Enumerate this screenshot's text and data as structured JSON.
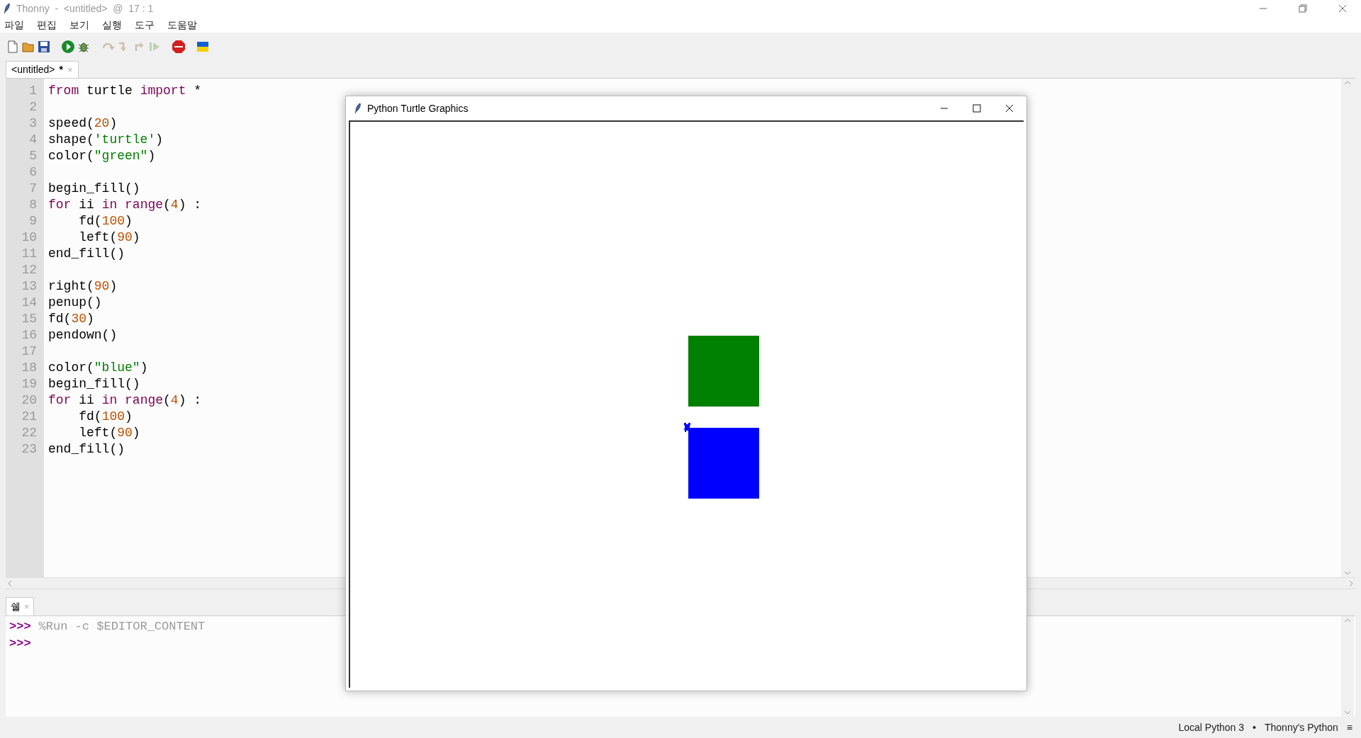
{
  "window": {
    "title": "Thonny  -  <untitled>  @  17 : 1"
  },
  "menu": [
    "파일",
    "편집",
    "보기",
    "실행",
    "도구",
    "도움말"
  ],
  "toolbar": [
    {
      "kind": "new",
      "disabled": false
    },
    {
      "kind": "open",
      "disabled": false
    },
    {
      "kind": "save",
      "disabled": false
    },
    {
      "kind": "run",
      "disabled": false
    },
    {
      "kind": "debug",
      "disabled": false
    },
    {
      "kind": "step_over",
      "disabled": true
    },
    {
      "kind": "step_into",
      "disabled": true
    },
    {
      "kind": "step_out",
      "disabled": true
    },
    {
      "kind": "resume",
      "disabled": true
    },
    {
      "kind": "stop",
      "disabled": false
    },
    {
      "kind": "flag",
      "disabled": false
    }
  ],
  "editor_tab": {
    "title": "<untitled>",
    "modified": "*",
    "close": "×",
    "selected": true
  },
  "code": [
    {
      "number": "1",
      "tokens": [
        {
          "text": "from",
          "kind": "kw"
        },
        {
          "text": " turtle ",
          "kind": "plain"
        },
        {
          "text": "import",
          "kind": "kw"
        },
        {
          "text": " *",
          "kind": "plain"
        }
      ]
    },
    {
      "number": "2"
    },
    {
      "number": "3",
      "tokens": [
        {
          "text": "speed(",
          "kind": "plain"
        },
        {
          "text": "20",
          "kind": "num"
        },
        {
          "text": ")",
          "kind": "plain"
        }
      ]
    },
    {
      "number": "4",
      "tokens": [
        {
          "text": "shape(",
          "kind": "plain"
        },
        {
          "text": "'turtle'",
          "kind": "str"
        },
        {
          "text": ")",
          "kind": "plain"
        }
      ]
    },
    {
      "number": "5",
      "tokens": [
        {
          "text": "color(",
          "kind": "plain"
        },
        {
          "text": "\"green\"",
          "kind": "str"
        },
        {
          "text": ")",
          "kind": "plain"
        }
      ]
    },
    {
      "number": "6"
    },
    {
      "number": "7",
      "tokens": [
        {
          "text": "begin_fill()",
          "kind": "plain"
        }
      ]
    },
    {
      "number": "8",
      "tokens": [
        {
          "text": "for",
          "kind": "kw"
        },
        {
          "text": " ii ",
          "kind": "plain"
        },
        {
          "text": "in range",
          "kind": "kw"
        },
        {
          "text": "(",
          "kind": "plain"
        },
        {
          "text": "4",
          "kind": "num"
        },
        {
          "text": ") :",
          "kind": "plain"
        }
      ]
    },
    {
      "number": "9",
      "tokens": [
        {
          "text": "    fd(",
          "kind": "plain"
        },
        {
          "text": "100",
          "kind": "num"
        },
        {
          "text": ")",
          "kind": "plain"
        }
      ]
    },
    {
      "number": "10",
      "tokens": [
        {
          "text": "    left(",
          "kind": "plain"
        },
        {
          "text": "90",
          "kind": "num"
        },
        {
          "text": ")",
          "kind": "plain"
        }
      ]
    },
    {
      "number": "11",
      "tokens": [
        {
          "text": "end_fill()",
          "kind": "plain"
        }
      ]
    },
    {
      "number": "12"
    },
    {
      "number": "13",
      "tokens": [
        {
          "text": "right(",
          "kind": "plain"
        },
        {
          "text": "90",
          "kind": "num"
        },
        {
          "text": ")",
          "kind": "plain"
        }
      ]
    },
    {
      "number": "14",
      "tokens": [
        {
          "text": "penup()",
          "kind": "plain"
        }
      ]
    },
    {
      "number": "15",
      "tokens": [
        {
          "text": "fd(",
          "kind": "plain"
        },
        {
          "text": "30",
          "kind": "num"
        },
        {
          "text": ")",
          "kind": "plain"
        }
      ]
    },
    {
      "number": "16",
      "tokens": [
        {
          "text": "pendown()",
          "kind": "plain"
        }
      ]
    },
    {
      "number": "17"
    },
    {
      "number": "18",
      "tokens": [
        {
          "text": "color(",
          "kind": "plain"
        },
        {
          "text": "\"blue\"",
          "kind": "str"
        },
        {
          "text": ")",
          "kind": "plain"
        }
      ]
    },
    {
      "number": "19",
      "tokens": [
        {
          "text": "begin_fill()",
          "kind": "plain"
        }
      ]
    },
    {
      "number": "20",
      "tokens": [
        {
          "text": "for",
          "kind": "kw"
        },
        {
          "text": " ii ",
          "kind": "plain"
        },
        {
          "text": "in range",
          "kind": "kw"
        },
        {
          "text": "(",
          "kind": "plain"
        },
        {
          "text": "4",
          "kind": "num"
        },
        {
          "text": ") :",
          "kind": "plain"
        }
      ]
    },
    {
      "number": "21",
      "tokens": [
        {
          "text": "    fd(",
          "kind": "plain"
        },
        {
          "text": "100",
          "kind": "num"
        },
        {
          "text": ")",
          "kind": "plain"
        }
      ]
    },
    {
      "number": "22",
      "tokens": [
        {
          "text": "    left(",
          "kind": "plain"
        },
        {
          "text": "90",
          "kind": "num"
        },
        {
          "text": ")",
          "kind": "plain"
        }
      ]
    },
    {
      "number": "23",
      "tokens": [
        {
          "text": "end_fill()",
          "kind": "plain"
        }
      ]
    }
  ],
  "shell_tab": {
    "title": "쉘",
    "close": "×",
    "selected": true
  },
  "shell": [
    {
      "prompt": ">>>",
      "command": "%Run -c $EDITOR_CONTENT"
    },
    {
      "prompt": ">>>"
    }
  ],
  "status_bar": {
    "interpreter": "Local Python 3",
    "separator": "•",
    "environment": "Thonny's Python",
    "menu": "≡"
  },
  "turtle_window": {
    "title": "Python Turtle Graphics",
    "shapes": [
      {
        "kind": "square",
        "color": "#008000"
      },
      {
        "kind": "square",
        "color": "#0000ff"
      },
      {
        "kind": "turtle",
        "color": "#0000ff"
      }
    ]
  }
}
